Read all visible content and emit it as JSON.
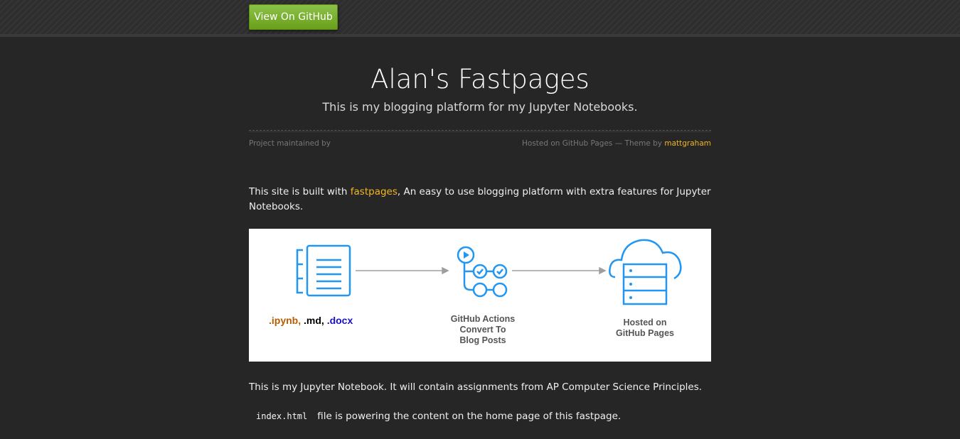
{
  "header": {
    "github_button": "View On GitHub"
  },
  "site": {
    "title": "Alan's Fastpages",
    "subtitle": "This is my blogging platform for my Jupyter Notebooks."
  },
  "meta": {
    "maintained": "Project maintained by",
    "hosted_prefix": "Hosted on GitHub Pages — Theme by ",
    "theme_author": "mattgraham"
  },
  "intro": {
    "before": "This site is built with ",
    "link": "fastpages",
    "after": ", An easy to use blogging platform with extra features for Jupyter Notebooks."
  },
  "diagram": {
    "label_ipynb": ".ipynb,",
    "label_md": " .md, ",
    "label_docx": ".docx",
    "actions_line1": "GitHub Actions",
    "actions_line2": "Convert To",
    "actions_line3": "Blog Posts",
    "hosted_line1": "Hosted on",
    "hosted_line2": "GitHub Pages",
    "colors": {
      "icon_blue": "#2196f3",
      "ipynb": "#b85c00",
      "docx": "#1a10c9",
      "arrow": "#9e9e9e"
    }
  },
  "para2": "This is my Jupyter Notebook. It will contain assignments from AP Computer Science Principles.",
  "para3": {
    "code": "index.html",
    "text": "file is powering the content on the home page of this fastpage."
  },
  "colors": {
    "accent": "#f3b623",
    "button_green": "#7cb82f",
    "background": "#262626"
  }
}
